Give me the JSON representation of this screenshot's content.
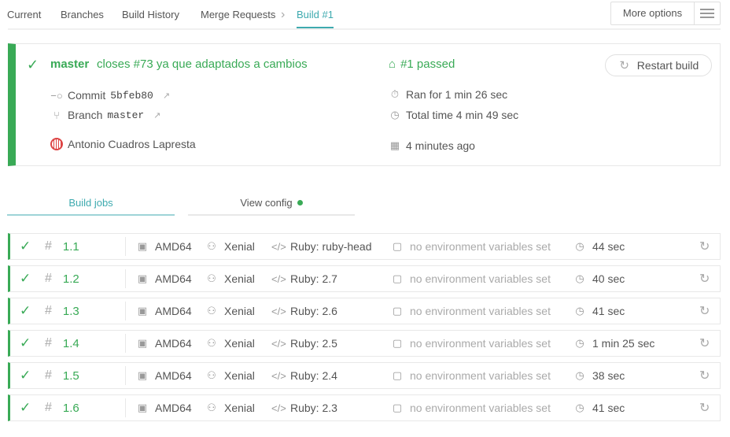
{
  "tabs": [
    {
      "label": "Current"
    },
    {
      "label": "Branches"
    },
    {
      "label": "Build History"
    },
    {
      "label": "Merge Requests"
    },
    {
      "label": "Build #1"
    }
  ],
  "more_options": "More options",
  "build": {
    "branch": "master",
    "message": "closes #73 ya que adaptados a cambios",
    "commit_label": "Commit",
    "commit_sha": "5bfeb80",
    "branch_label": "Branch",
    "branch_value": "master",
    "author": "Antonio Cuadros Lapresta",
    "status": "#1 passed",
    "ran_for": "Ran for 1 min 26 sec",
    "total_time": "Total time 4 min 49 sec",
    "finished": "4 minutes ago",
    "restart_label": "Restart build",
    "status_color": "#39aa56"
  },
  "subtabs": {
    "jobs": "Build jobs",
    "config": "View config"
  },
  "jobs": [
    {
      "num": "1.1",
      "arch": "AMD64",
      "os": "Xenial",
      "lang": "Ruby: ruby-head",
      "env": "no environment variables set",
      "duration": "44 sec"
    },
    {
      "num": "1.2",
      "arch": "AMD64",
      "os": "Xenial",
      "lang": "Ruby: 2.7",
      "env": "no environment variables set",
      "duration": "40 sec"
    },
    {
      "num": "1.3",
      "arch": "AMD64",
      "os": "Xenial",
      "lang": "Ruby: 2.6",
      "env": "no environment variables set",
      "duration": "41 sec"
    },
    {
      "num": "1.4",
      "arch": "AMD64",
      "os": "Xenial",
      "lang": "Ruby: 2.5",
      "env": "no environment variables set",
      "duration": "1 min 25 sec"
    },
    {
      "num": "1.5",
      "arch": "AMD64",
      "os": "Xenial",
      "lang": "Ruby: 2.4",
      "env": "no environment variables set",
      "duration": "38 sec"
    },
    {
      "num": "1.6",
      "arch": "AMD64",
      "os": "Xenial",
      "lang": "Ruby: 2.3",
      "env": "no environment variables set",
      "duration": "41 sec"
    }
  ]
}
